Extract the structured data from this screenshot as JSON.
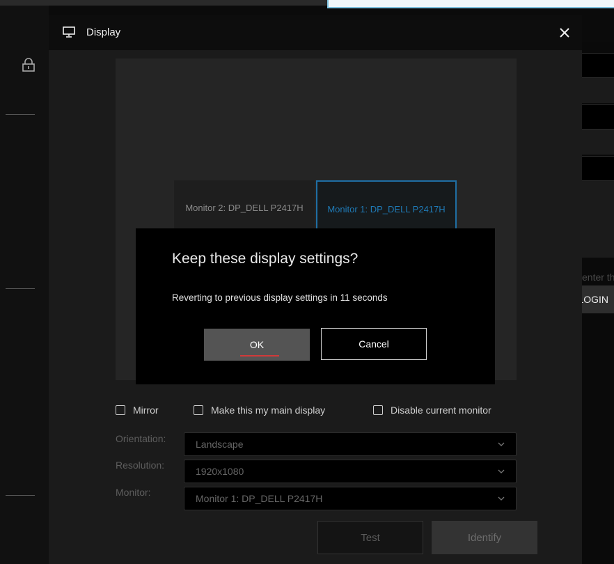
{
  "window": {
    "title": "Display"
  },
  "background": {
    "right_hint": "enter the DO",
    "login_label": "LOGIN"
  },
  "monitors": [
    {
      "label": "Monitor 2: DP_DELL P2417H",
      "selected": false
    },
    {
      "label": "Monitor 1: DP_DELL P2417H",
      "selected": true
    }
  ],
  "modal": {
    "title": "Keep these display settings?",
    "message": "Reverting to previous display settings in 11 seconds",
    "ok_label": "OK",
    "cancel_label": "Cancel"
  },
  "options": {
    "mirror_label": "Mirror",
    "mirror_checked": false,
    "main_display_label": "Make this my main display",
    "main_display_checked": false,
    "disable_label": "Disable current monitor",
    "disable_checked": false
  },
  "fields": {
    "orientation_label": "Orientation:",
    "orientation_value": "Landscape",
    "resolution_label": "Resolution:",
    "resolution_value": "1920x1080",
    "monitor_label": "Monitor:",
    "monitor_value": "Monitor 1: DP_DELL P2417H"
  },
  "buttons": {
    "test_label": "Test",
    "identify_label": "Identify"
  },
  "colors": {
    "selected_monitor_accent": "#1f6ea3",
    "ok_focus_underline": "#d13a3a",
    "modal_background": "#000000",
    "dialog_background": "#1b1b1b"
  },
  "icons": {
    "header": "monitor-icon",
    "close": "close-icon",
    "sidebar": "lock-icon",
    "dropdown": "chevron-down-icon",
    "checkbox": "checkbox-icon"
  }
}
